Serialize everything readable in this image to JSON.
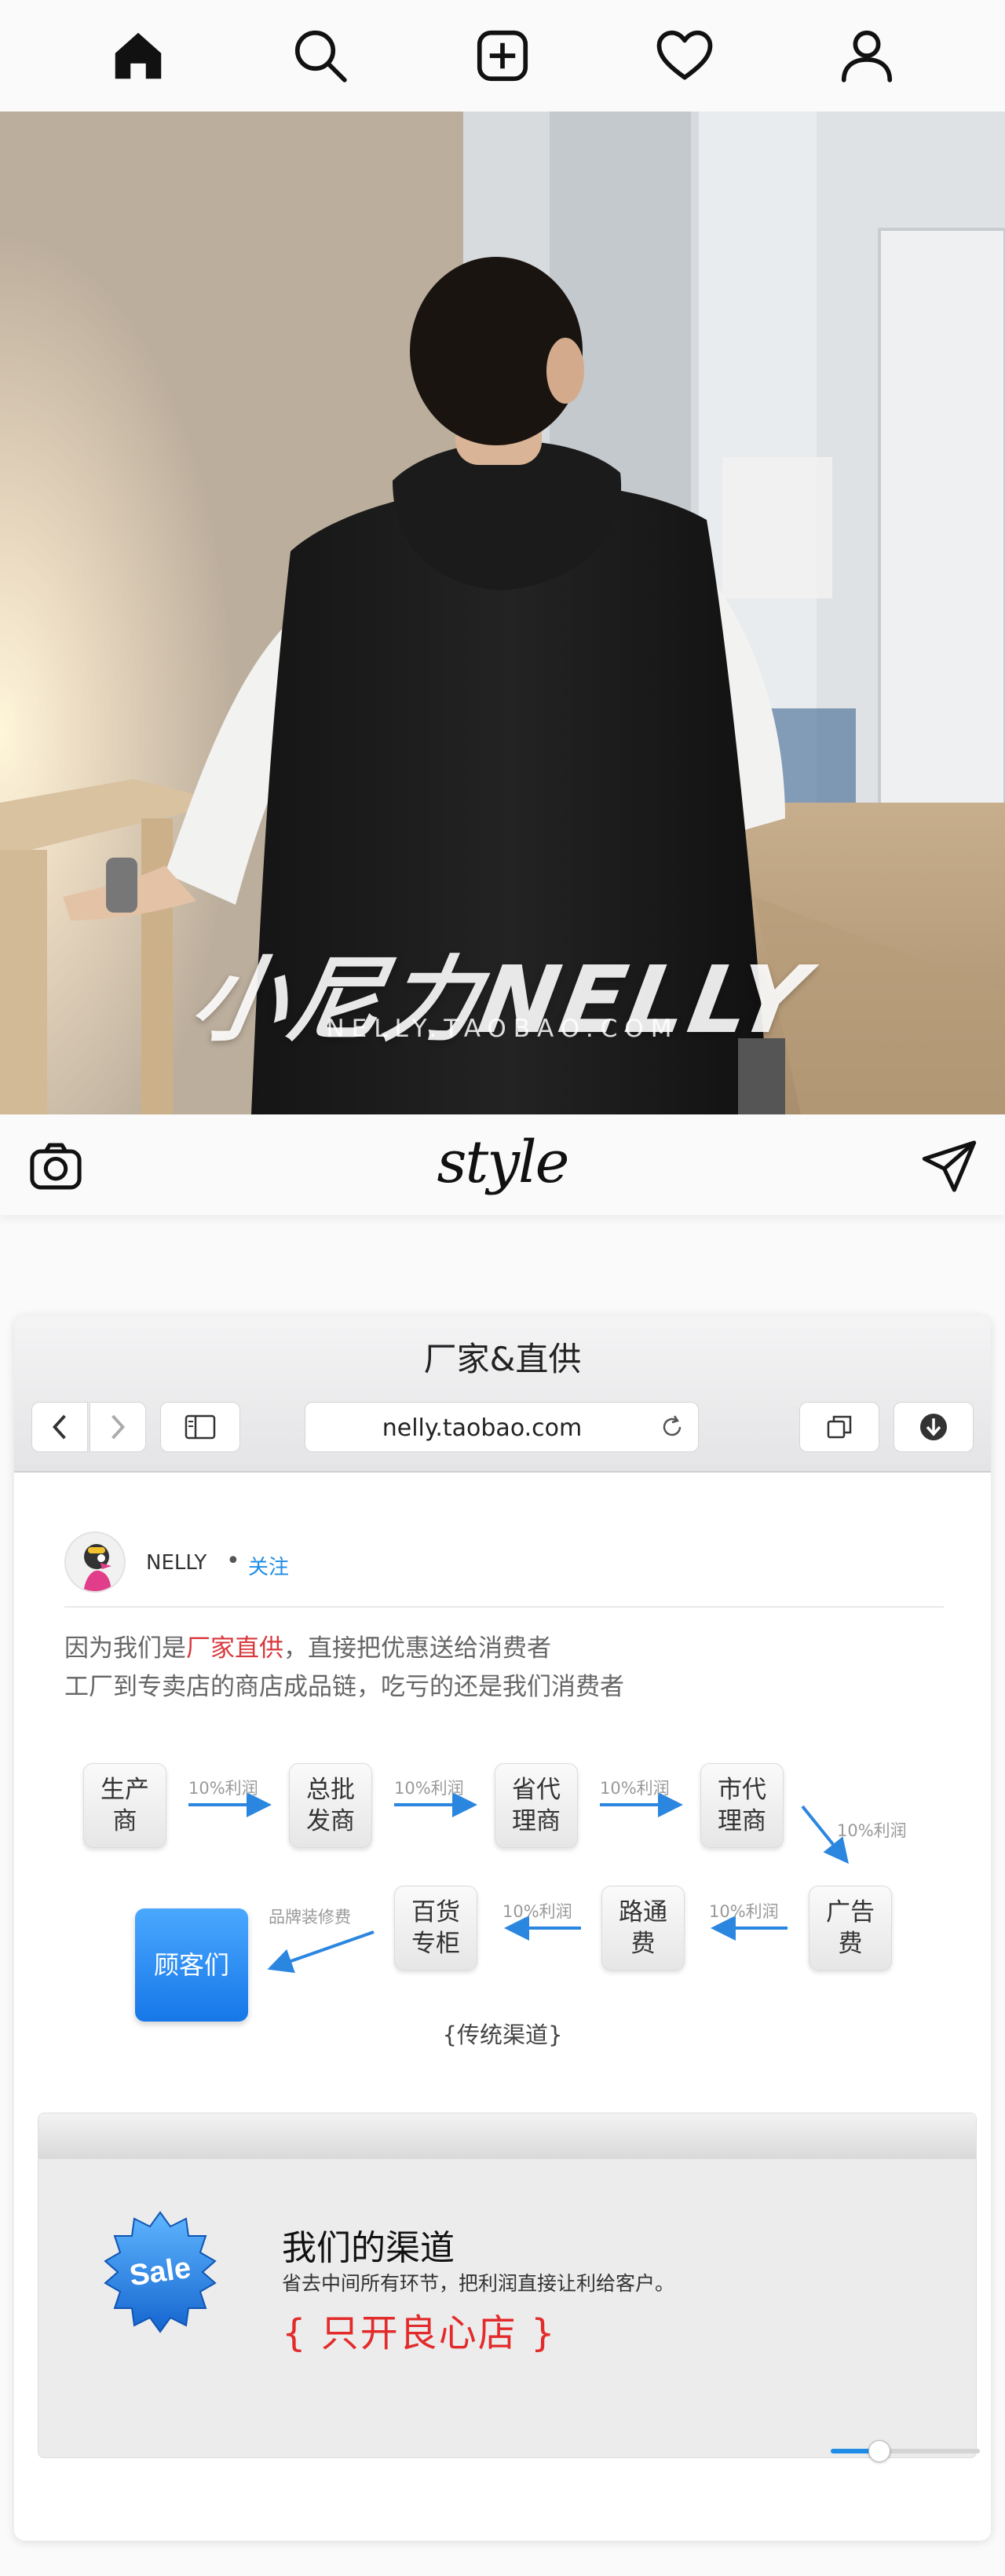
{
  "topnav": {
    "items": [
      "home-icon",
      "search-icon",
      "add-post-icon",
      "heart-icon",
      "profile-icon"
    ]
  },
  "hero": {
    "watermark_logo": "小尼力NELLY",
    "watermark_url": "NELLY.TAOBAO.COM"
  },
  "postbar": {
    "brand": "style",
    "left_icon": "camera-icon",
    "right_icon": "send-icon"
  },
  "browser": {
    "title": "厂家&直供",
    "url": "nelly.taobao.com"
  },
  "post": {
    "username": "NELLY",
    "separator": "•",
    "follow_label": "关注",
    "desc1_pre": "因为我们是",
    "desc1_red": "厂家直供",
    "desc1_post": "，直接把优惠送给消费者",
    "desc2": "工厂到专卖店的商店成品链，吃亏的还是我们消费者"
  },
  "flow": {
    "nodes": [
      "生产\n商",
      "总批\n发商",
      "省代\n理商",
      "市代\n理商",
      "广告\n费",
      "路通\n费",
      "百货\n专柜",
      "顾客们"
    ],
    "profit_label": "10%利润",
    "decor_label": "品牌装修费",
    "caption": "{传统渠道}"
  },
  "sale": {
    "badge": "Sale",
    "title": "我们的渠道",
    "subtitle": "省去中间所有环节，把利润直接让利给客户。",
    "slogan": "{ 只开良心店 }"
  },
  "colors": {
    "accent_blue": "#1f8de6",
    "red": "#d8383c",
    "slogan_red": "#e32b2b"
  }
}
